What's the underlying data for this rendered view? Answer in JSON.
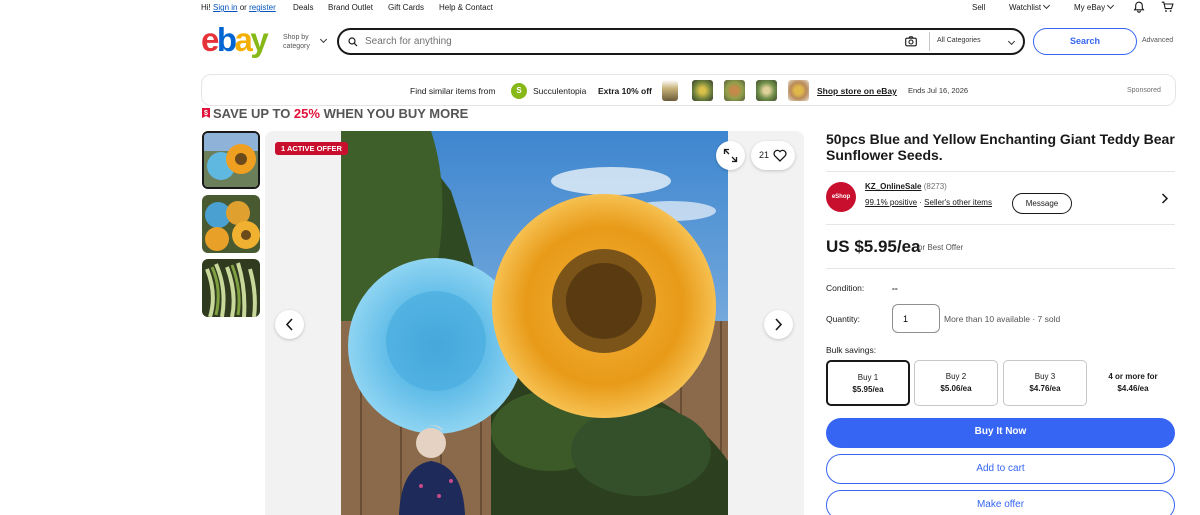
{
  "topnav": {
    "hi": "Hi!",
    "sign_in": "Sign in",
    "or": "or",
    "register": "register",
    "deals": "Deals",
    "brand_outlet": "Brand Outlet",
    "gift_cards": "Gift Cards",
    "help_contact": "Help & Contact",
    "sell": "Sell",
    "watchlist": "Watchlist",
    "my_ebay": "My eBay"
  },
  "header": {
    "logo": {
      "e": "e",
      "b": "b",
      "a": "a",
      "y": "y"
    },
    "shop_by_1": "Shop by",
    "shop_by_2": "category",
    "search_placeholder": "Search for anything",
    "category": "All Categories",
    "search_button": "Search",
    "advanced": "Advanced"
  },
  "banner": {
    "find_similar": "Find similar items from",
    "store_initial": "S",
    "store_name": "Succulentopia",
    "discount": "Extra 10% off",
    "shop_store": "Shop store on eBay",
    "ends": "Ends Jul 16, 2026",
    "sponsored": "Sponsored"
  },
  "promo": {
    "prefix": "SAVE UP TO ",
    "pct": "25%",
    "suffix": " WHEN YOU BUY MORE"
  },
  "gallery": {
    "active_offer": "1 ACTIVE OFFER",
    "watch_count": "21"
  },
  "item": {
    "title": "50pcs Blue and Yellow Enchanting Giant Teddy Bear Sunflower Seeds.",
    "seller": {
      "logo_text": "eShop",
      "name": "KZ_OnlineSale",
      "feedback": "(8273)",
      "positive": "99.1% positive",
      "other_items": "Seller's other items",
      "message": "Message"
    },
    "price": "US $5.95/ea",
    "price_sub": "or Best Offer",
    "condition_label": "Condition:",
    "condition_value": "--",
    "quantity_label": "Quantity:",
    "quantity_value": "1",
    "availability": "More than 10 available · 7 sold",
    "bulk_label": "Bulk savings:",
    "bulk": [
      {
        "qty": "Buy 1",
        "price": "$5.95/ea"
      },
      {
        "qty": "Buy 2",
        "price": "$5.06/ea"
      },
      {
        "qty": "Buy 3",
        "price": "$4.76/ea"
      },
      {
        "qty": "4 or more for",
        "price": "$4.46/ea"
      }
    ],
    "buy_now": "Buy It Now",
    "add_to_cart": "Add to cart",
    "make_offer": "Make offer"
  },
  "colors": {
    "accent_blue": "#3665f3",
    "link_blue": "#0654ba",
    "offer_red": "#e0103a"
  }
}
